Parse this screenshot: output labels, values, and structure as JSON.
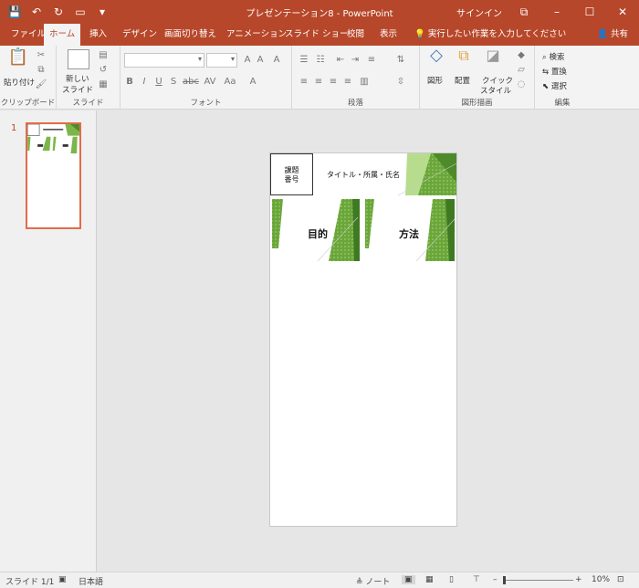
{
  "titlebar": {
    "title": "プレゼンテーション8  -  PowerPoint",
    "signin": "サインイン",
    "save_icon": "💾",
    "undo_icon": "↶",
    "redo_icon": "↻",
    "present_icon": "▭",
    "more_icon": "▾",
    "ribbon_display_icon": "⧉",
    "minimize_icon": "–",
    "maximize_icon": "☐",
    "close_icon": "✕"
  },
  "tabs": [
    {
      "label": "ファイル"
    },
    {
      "label": "ホーム"
    },
    {
      "label": "挿入"
    },
    {
      "label": "デザイン"
    },
    {
      "label": "画面切り替え"
    },
    {
      "label": "アニメーション"
    },
    {
      "label": "スライド ショー"
    },
    {
      "label": "校閲"
    },
    {
      "label": "表示"
    }
  ],
  "tell_me": "実行したい作業を入力してください",
  "share": "共有",
  "ribbon": {
    "clipboard": {
      "label": "クリップボード",
      "paste": "貼り付け"
    },
    "slides": {
      "label": "スライド",
      "new_slide_1": "新しい",
      "new_slide_2": "スライド"
    },
    "font": {
      "label": "フォント",
      "font_name": "",
      "font_size": ""
    },
    "paragraph": {
      "label": "段落"
    },
    "drawing": {
      "label": "図形描画",
      "shapes": "図形",
      "arrange": "配置",
      "quick_styles_1": "クイック",
      "quick_styles_2": "スタイル"
    },
    "editing": {
      "label": "編集",
      "find": "検索",
      "replace": "置換",
      "select": "選択"
    }
  },
  "thumbnail": {
    "number": "1"
  },
  "slide": {
    "number_label_1": "課題",
    "number_label_2": "番号",
    "title_line": "タイトル・所属・氏名",
    "heading_left": "目的",
    "heading_right": "方法",
    "accent_color": "#7ab648"
  },
  "statusbar": {
    "slide_info": "スライド 1/1",
    "language": "日本語",
    "notes": "ノート",
    "zoom": "10%"
  }
}
